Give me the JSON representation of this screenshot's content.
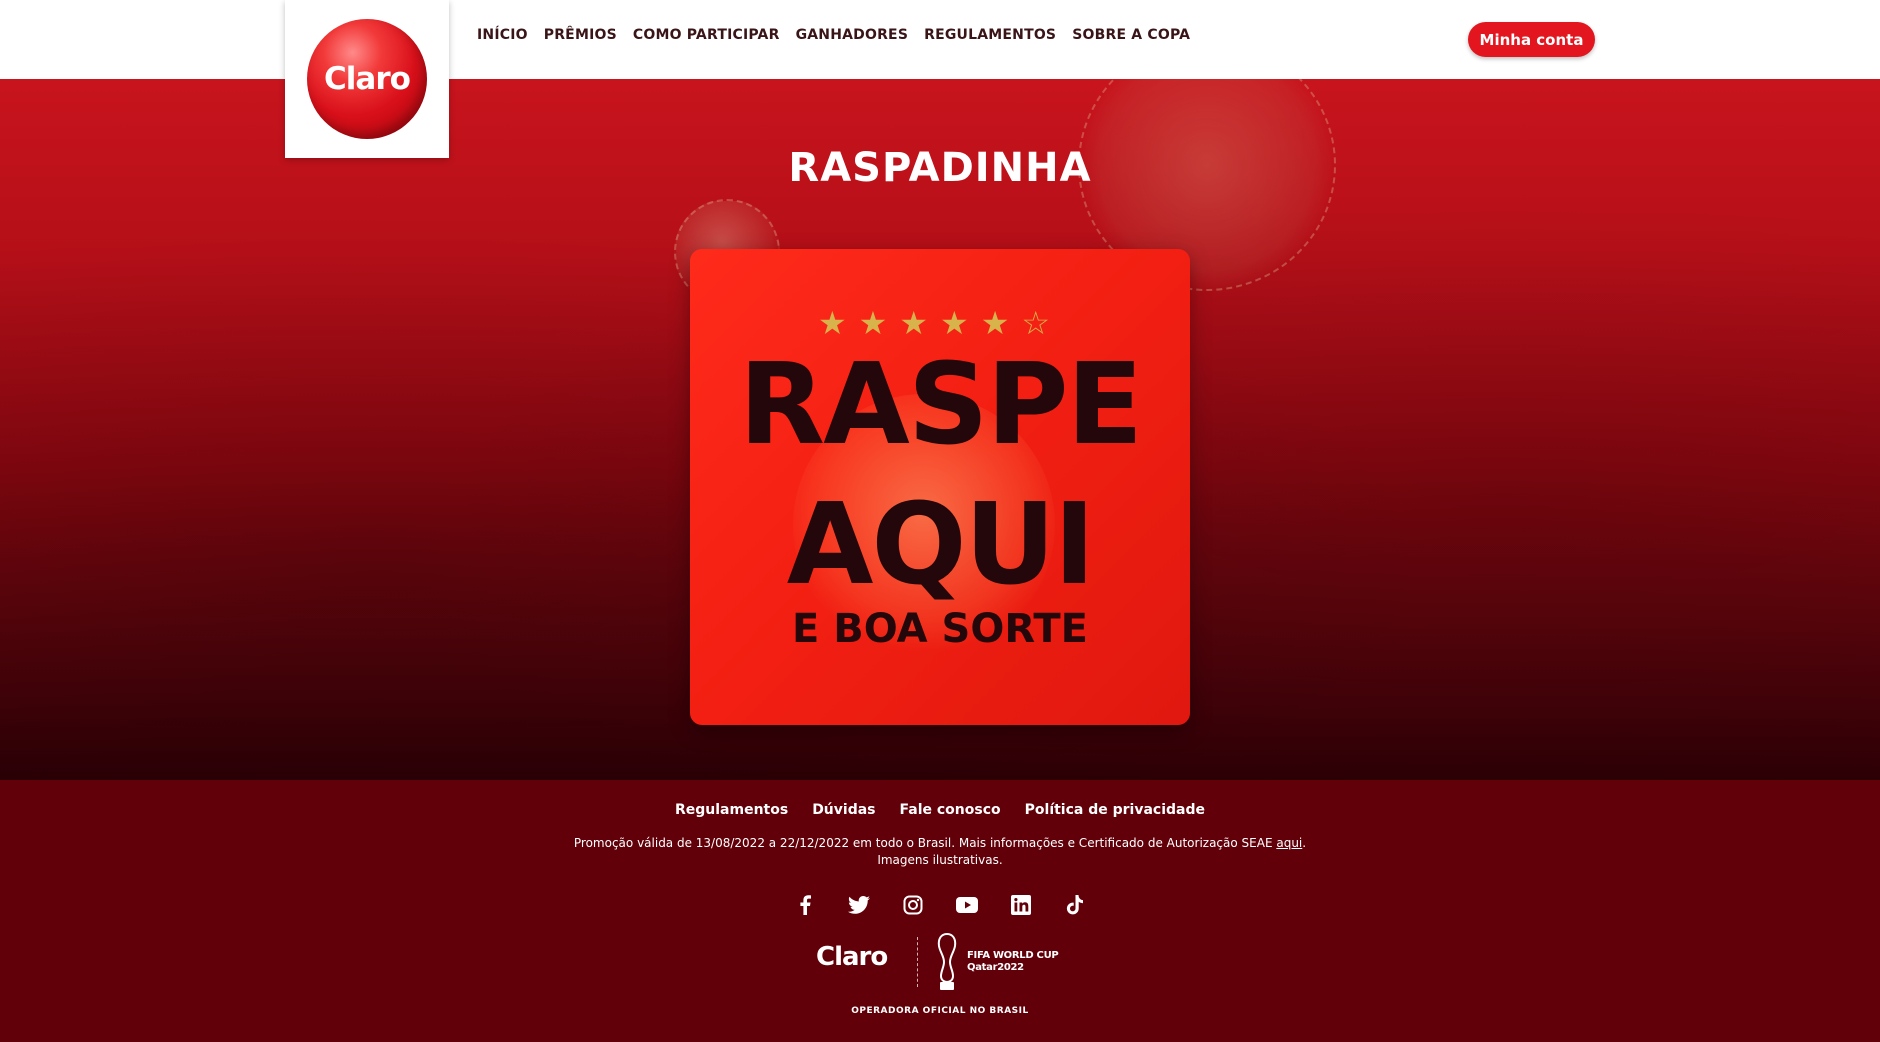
{
  "header": {
    "logo_text": "Claro",
    "nav": [
      {
        "label": "INÍCIO"
      },
      {
        "label": "PRÊMIOS"
      },
      {
        "label": "COMO PARTICIPAR"
      },
      {
        "label": "GANHADORES"
      },
      {
        "label": "REGULAMENTOS"
      },
      {
        "label": "SOBRE A COPA"
      }
    ],
    "account_label": "Minha conta"
  },
  "hero": {
    "title": "RASPADINHA",
    "card": {
      "stars": "★★★★★☆",
      "line1": "RASPE",
      "line2": "AQUI",
      "line3": "E BOA SORTE"
    }
  },
  "footer": {
    "links": [
      {
        "label": "Regulamentos"
      },
      {
        "label": "Dúvidas"
      },
      {
        "label": "Fale conosco"
      },
      {
        "label": "Política de privacidade"
      }
    ],
    "note_prefix": "Promoção válida de 13/08/2022 a 22/12/2022 em todo o Brasil. Mais informações e Certificado de Autorização SEAE ",
    "note_link": "aqui",
    "note_suffix": ".",
    "note_line2": "Imagens ilustrativas.",
    "socials": [
      "facebook-icon",
      "twitter-icon",
      "instagram-icon",
      "youtube-icon",
      "linkedin-icon",
      "tiktok-icon"
    ],
    "brand_claro": "Claro",
    "fifa_line1": "FIFA WORLD CUP",
    "fifa_line2": "Qatar2022",
    "official_text": "OPERADORA OFICIAL NO BRASIL"
  },
  "colors": {
    "brand_red": "#e3151f",
    "footer_bg": "#620009",
    "star_gold": "#d8b24a"
  }
}
